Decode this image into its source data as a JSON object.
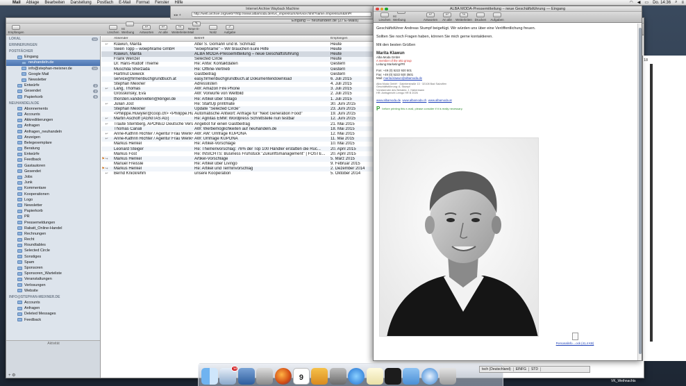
{
  "menubar": {
    "app": "Mail",
    "items": [
      "Ablage",
      "Bearbeiten",
      "Darstellung",
      "Postfach",
      "E-Mail",
      "Format",
      "Fenster",
      "Hilfe"
    ],
    "clock": "Do. 14:36"
  },
  "browser": {
    "title": "Internet Archive Wayback Machine",
    "url": "http://web.archive.org/web/*/http://www.albamoda.de/svc_impressum/service.html?name=Impressum&lmPr"
  },
  "mail_window": {
    "title": "Eingang — neuhandeln.de (27 E-Mails)",
    "toolbar": [
      "Empfangen",
      "Löschen",
      "Ist Werbung",
      "Antworten",
      "An alle",
      "Weiterleiten",
      "Neue E-Mail",
      "Notiz",
      "Aufgabe"
    ],
    "activity_label": "Aktivität"
  },
  "sidebar": {
    "section_local": "LOKAL",
    "local_badge": "14",
    "section_reminders": "ERINNERUNGEN",
    "section_mailboxes": "POSTFÄCHER",
    "mailboxes": [
      {
        "label": "Eingang",
        "level": 1,
        "badge": ""
      },
      {
        "label": "neuhandeln.de",
        "level": 3,
        "badge": "",
        "selected": true
      },
      {
        "label": "info@stephan-meixner.de",
        "level": 3,
        "badge": "14"
      },
      {
        "label": "Google Mail",
        "level": 3,
        "badge": ""
      },
      {
        "label": "Newsletter",
        "level": 3,
        "badge": ""
      },
      {
        "label": "Entwürfe",
        "level": 1,
        "badge": "2"
      },
      {
        "label": "Gesendet",
        "level": 1,
        "badge": "2"
      },
      {
        "label": "Papierkorb",
        "level": 1,
        "badge": "6"
      }
    ],
    "section_neuhandeln": "NEUHANDELN.DE",
    "neuhandeln_folders": [
      "Abonnements",
      "Accounts",
      "Akkreditierungen",
      "Anfragen",
      "Anfragen_neuhandeln",
      "Anzeigen",
      "Belegexemplare",
      "Beratung",
      "Entwürfe",
      "Feedback",
      "Gastautoren",
      "Gesendet",
      "Jobs",
      "Junk",
      "Kommentare",
      "Kooperationen",
      "Logo",
      "Newsletter",
      "Papierkorb",
      "PR",
      "Pressemeldungen",
      "Rabatt_Online-Handel",
      "Rechnungen",
      "Recht",
      "Roundtables",
      "Selected Circle",
      "Sonstiges",
      "Spam",
      "Sponsoren",
      "Sponsoren_Warteliste",
      "Veranstaltungen",
      "Verlosungen",
      "Website"
    ],
    "section_info": "INFO@STEPHAN-MEIXNER.DE",
    "info_folders": [
      "Accounts",
      "Anfragen",
      "Deleted Messages",
      "Feedback"
    ]
  },
  "list": {
    "columns": {
      "from": "Absender",
      "subject": "Betreff",
      "date": "Empfangen"
    },
    "rows": [
      {
        "icon": "↩",
        "from": "Klawun, Marita",
        "subject": "Alter S. Gömann und B. Schmalz",
        "date": "Heute"
      },
      {
        "icon": "",
        "from": "Swen Topp – wowphrame GmbH",
        "subject": "\"wowphrame\" – Wir brauchen Eure Hilfe",
        "date": "Heute"
      },
      {
        "icon": "",
        "from": "Klawun, Marita",
        "subject": "ALBA MODA-Pressemitteilung – neue Geschäftsführung",
        "date": "Heute",
        "selected": true
      },
      {
        "icon": "",
        "from": "Frank Wenzel",
        "subject": "Selected Circle",
        "date": "Heute"
      },
      {
        "icon": "",
        "from": "Dr. Hans-Rudolf Thieme",
        "subject": "Re: Antw: Kontaktdaten",
        "date": "Gestern"
      },
      {
        "icon": "",
        "from": "Muschda Sherzada",
        "subject": "Re: Offline-Vertrieb",
        "date": "Gestern"
      },
      {
        "icon": "",
        "from": "Hartmut Deiwick",
        "subject": "Gastbeitrag",
        "date": "Gestern"
      },
      {
        "icon": "",
        "from": "service@firmenbuchgrundbuch.at",
        "subject": "easy.firmenbuchgrundbuch.at Dokumentendownload",
        "date": "6. Juli 2015"
      },
      {
        "icon": "",
        "from": "Stephan Meixner",
        "subject": "Adresslisten",
        "date": "4. Juli 2015"
      },
      {
        "icon": "↩",
        "from": "Lang, Thomas",
        "subject": "AW: Amazon Fire Phone",
        "date": "3. Juli 2015"
      },
      {
        "icon": "",
        "from": "Grosskinsky, Eva",
        "subject": "AW: Vorwürfe von Weltbild",
        "date": "2. Juli 2015"
      },
      {
        "icon": "",
        "from": "thorsten.vandervelten@klingel.de",
        "subject": "Re: Artikel über Stilago",
        "date": "1. Juli 2015"
      },
      {
        "icon": "↩",
        "from": "Julian Jost",
        "subject": "Re: StartUp printmate",
        "date": "30. Juni 2015"
      },
      {
        "icon": "",
        "from": "Stephan Meixner",
        "subject": "Update \"Selected Circle\"",
        "date": "23. Juni 2015"
      },
      {
        "icon": "",
        "from": "<Philippe.Huwyler@coop.ch> <Philippe.Huwyl...",
        "subject": "Automatische Antwort: Anfrage für \"Next Generation Food\"",
        "date": "19. Juni 2015"
      },
      {
        "icon": "↩",
        "from": "Martin Aschoff (AGNITAS AG)",
        "subject": "Re: Agnitas EMM: Wordpress Schnittstelle nun testbar",
        "date": "12. Juni 2015"
      },
      {
        "icon": "↩",
        "from": "Traute Sternberg, APONED Deutsche Versand-...",
        "subject": "Angebot für einen Gastbeitrag",
        "date": "21. Mai 2015"
      },
      {
        "icon": "",
        "from": "Thomas Canali",
        "subject": "AW: Werbemöglichkeiten auf neuhandeln.de",
        "date": "18. Mai 2015"
      },
      {
        "icon": "↩",
        "from": "Anne-Kathrin Richter / Agentur Frau Wenk+++",
        "subject": "AW: AW: Umfrage KUPONA",
        "date": "12. Mai 2015"
      },
      {
        "icon": "↩",
        "from": "Anne-Kathrin Richter / Agentur Frau Wenk+++",
        "subject": "AW: Umfrage KUPONA",
        "date": "11. Mai 2015"
      },
      {
        "icon": "",
        "from": "Markus Henkel",
        "subject": "Re: Artikel-Vorschläge",
        "date": "10. Mai 2015"
      },
      {
        "icon": "",
        "from": "Leonard Steiger",
        "subject": "Re: Themenvorschlag: 76% der Top 100 Händler erstatten die Rüc...",
        "date": "20. April 2015"
      },
      {
        "icon": "",
        "from": "Markus Fost",
        "subject": "Re: INSICHTS: Business Frühstück \"Zukunftsmanagement\" | FOSTE...",
        "date": "20. April 2015"
      },
      {
        "icon": "↪",
        "flag": "orange",
        "from": "Markus Henkel",
        "subject": "Artikel-Vorschläge",
        "date": "5. März 2015"
      },
      {
        "icon": "",
        "from": "Manuel Freissle",
        "subject": "Re: Artikel über Livingo",
        "date": "9. Februar 2015"
      },
      {
        "icon": "↪",
        "flag": "orange",
        "from": "Markus Henkel",
        "subject": "Re: Artikel und Terminvorschlag",
        "date": "2. Dezember 2014"
      },
      {
        "icon": "↩",
        "from": "Bernd Knickrehm",
        "subject": "unsere Kooperation",
        "date": "5. Oktober 2014"
      }
    ]
  },
  "message": {
    "title": "ALBA MODA-Pressemitteilung – neue Geschäftsführung — Eingang",
    "toolbar": [
      "Löschen",
      "Ist Werbung",
      "Antworten",
      "An alle",
      "Weiterleiten",
      "Drucken",
      "Aufgaben"
    ],
    "intro": "Geschäftsführer Andreas Stumpf beigefügt. Wir würden uns über eine Veröffentlichung freuen.",
    "questions": "Sollten Sie noch Fragen haben, können Sie mich gerne kontaktieren.",
    "greeting": "Mit den besten Grüßen",
    "sig_name": "Marita Klawun",
    "sig_company": "Alba Moda GmbH",
    "sig_group": "A member of the otto group",
    "sig_role": "Leitung Marketing/PR",
    "sig_phone": "Fon: +49 (0) 5222 920 501",
    "sig_fax": "Fax: +49 (0) 5222 920 3501",
    "sig_mail_label": "Mail:",
    "sig_mail": "marita.klawun@albamoda.de",
    "legal_1": "Alba Moda GmbH · Daimlerstraße 13 · 32108 Bad Salzuflen",
    "legal_2": "Geschäftsführung: A. Stumpf",
    "legal_3": "Vorsitzender des Beirates: J. Habermann",
    "legal_4": "HR: Amtsgericht Lemgo HR B 2026",
    "links": [
      "www.albamoda.de",
      "www.albamoda.ch",
      "www.albamoda.at"
    ],
    "green_note": "before printing this e-mail, please consider if it is really necessary.",
    "attachment": "Personalinfo....ock (41,4 KB)"
  },
  "right_window": {
    "number": "18"
  },
  "dock": {
    "badge_mail": "14",
    "calendar_day": "9",
    "icons": [
      "finder-icon",
      "mail-icon",
      "photo-icon",
      "calculator-icon",
      "firefox-icon",
      "calendar-icon",
      "sketch-icon",
      "preferences-icon",
      "itunes-icon",
      "notes-icon",
      "terminal-icon",
      "folder-icon",
      "safari-icon",
      "trash-icon"
    ]
  },
  "status_strip": {
    "lang": "tsch (Deutschland)",
    "mode": "EINFG",
    "std": "STD"
  },
  "desktop_label": "VK_Weihnachts"
}
